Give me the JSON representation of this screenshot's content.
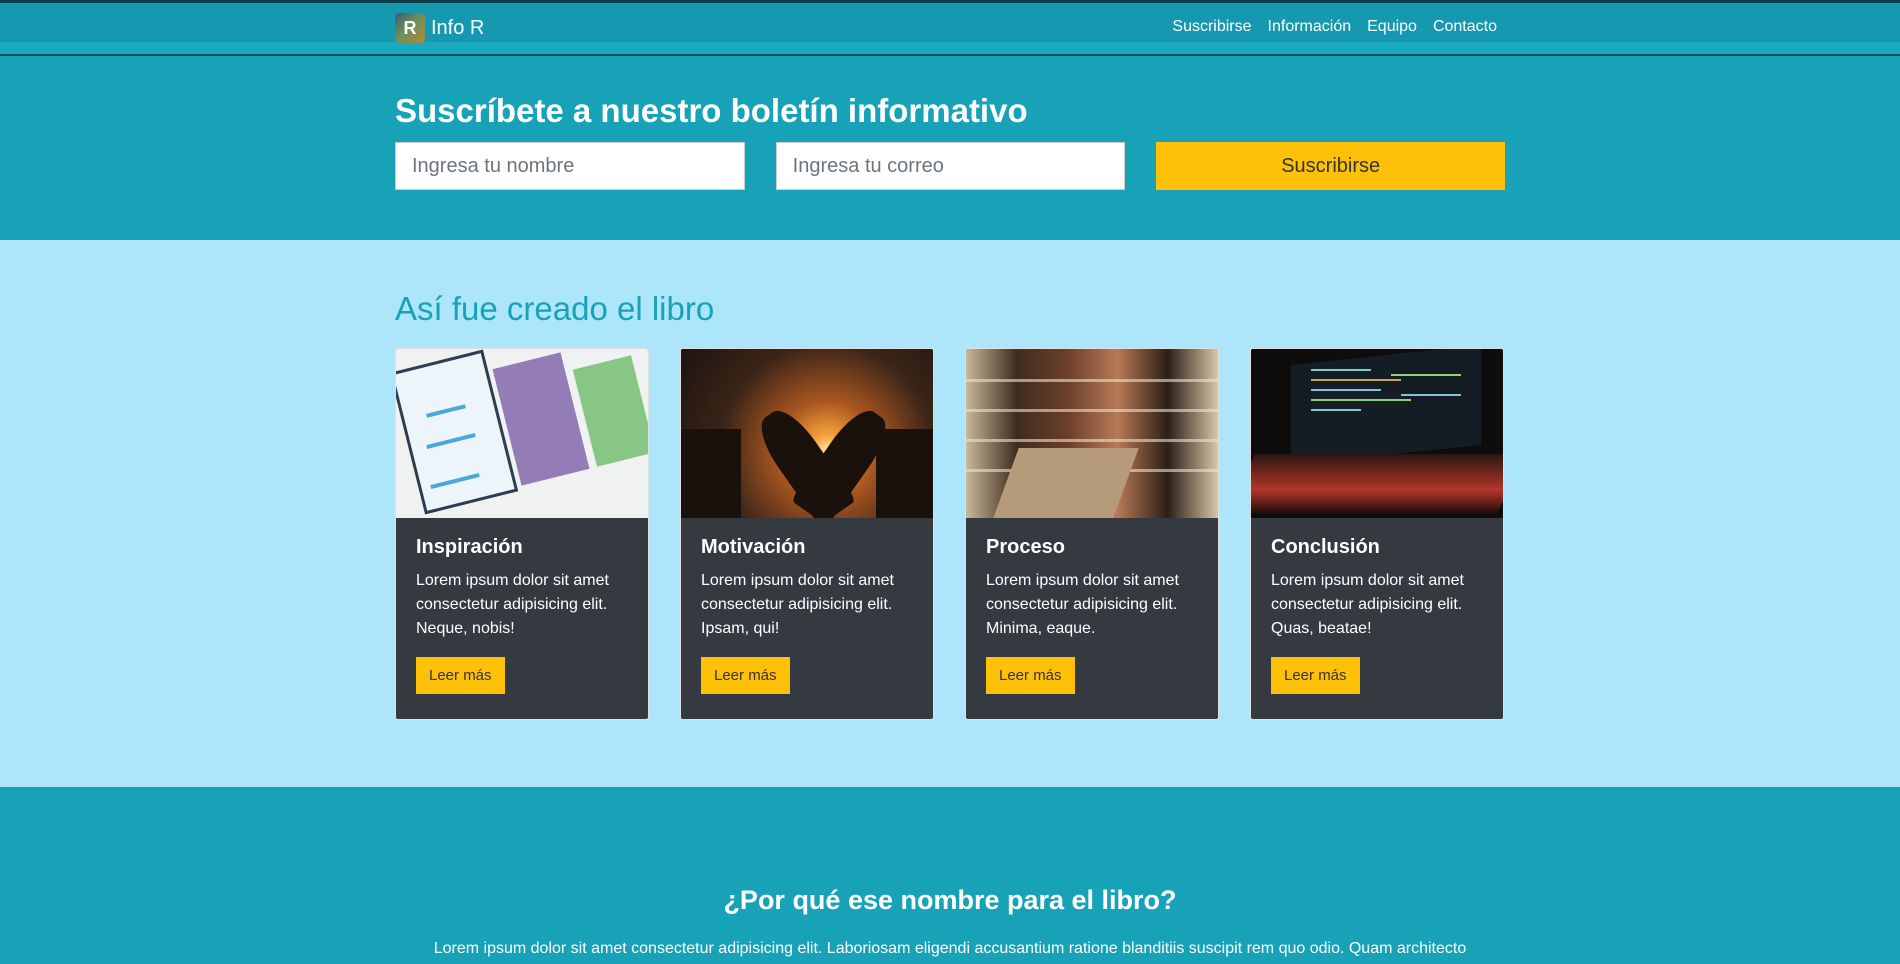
{
  "navbar": {
    "brand": "Info R",
    "logo_letter": "R",
    "links": [
      "Suscribirse",
      "Información",
      "Equipo",
      "Contacto"
    ]
  },
  "subscribe": {
    "title": "Suscríbete a nuestro boletín informativo",
    "name_placeholder": "Ingresa tu nombre",
    "email_placeholder": "Ingresa tu correo",
    "button": "Suscribirse"
  },
  "book": {
    "title": "Así fue creado el libro",
    "cards": [
      {
        "title": "Inspiración",
        "text": "Lorem ipsum dolor sit amet consectetur adipisicing elit. Neque, nobis!",
        "button": "Leer más",
        "image": "wireframe-sketch"
      },
      {
        "title": "Motivación",
        "text": "Lorem ipsum dolor sit amet consectetur adipisicing elit. Ipsam, qui!",
        "button": "Leer más",
        "image": "heart-hands-sunset"
      },
      {
        "title": "Proceso",
        "text": "Lorem ipsum dolor sit amet consectetur adipisicing elit. Minima, eaque.",
        "button": "Leer más",
        "image": "library-shelves"
      },
      {
        "title": "Conclusión",
        "text": "Lorem ipsum dolor sit amet consectetur adipisicing elit. Quas, beatae!",
        "button": "Leer más",
        "image": "laptop-code"
      }
    ]
  },
  "why": {
    "title": "¿Por qué ese nombre para el libro?",
    "text": "Lorem ipsum dolor sit amet consectetur adipisicing elit. Laboriosam eligendi accusantium ratione blanditiis suscipit rem quo odio. Quam architecto"
  },
  "colors": {
    "primary": "#17a2b8",
    "accent": "#ffc107",
    "light_bg": "#ade6fa",
    "card_bg": "#343a40"
  }
}
